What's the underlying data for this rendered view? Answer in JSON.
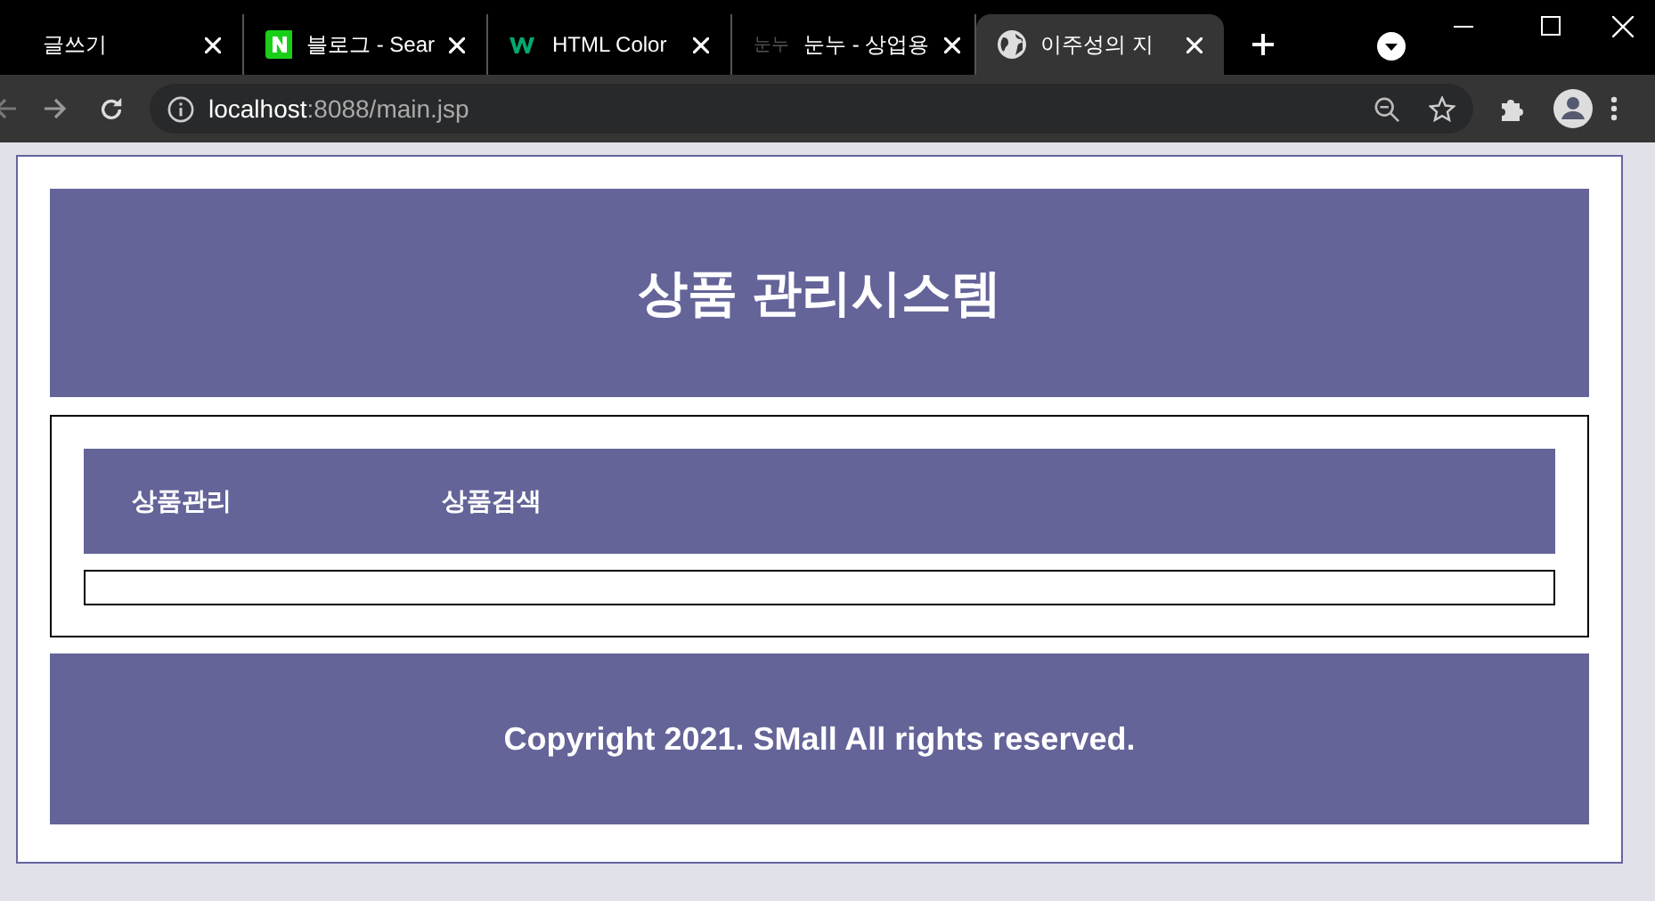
{
  "browser": {
    "tabs": [
      {
        "title": "글쓰기",
        "kind": "plain",
        "selected": false
      },
      {
        "title": "블로그 - Sear",
        "kind": "naver",
        "selected": false
      },
      {
        "title": "HTML Color",
        "kind": "w3",
        "selected": false
      },
      {
        "title": "눈누 - 상업용",
        "kind": "text",
        "favicon_text": "눈누",
        "selected": false
      },
      {
        "title": "이주성의 지",
        "kind": "globe",
        "selected": true
      }
    ],
    "address": {
      "host": "localhost",
      "path": ":8088/main.jsp"
    }
  },
  "page": {
    "header": {
      "title": "상품 관리시스템"
    },
    "nav": [
      {
        "label": "상품관리"
      },
      {
        "label": "상품검색"
      }
    ],
    "footer": {
      "text": "Copyright 2021. SMall All rights reserved."
    }
  }
}
